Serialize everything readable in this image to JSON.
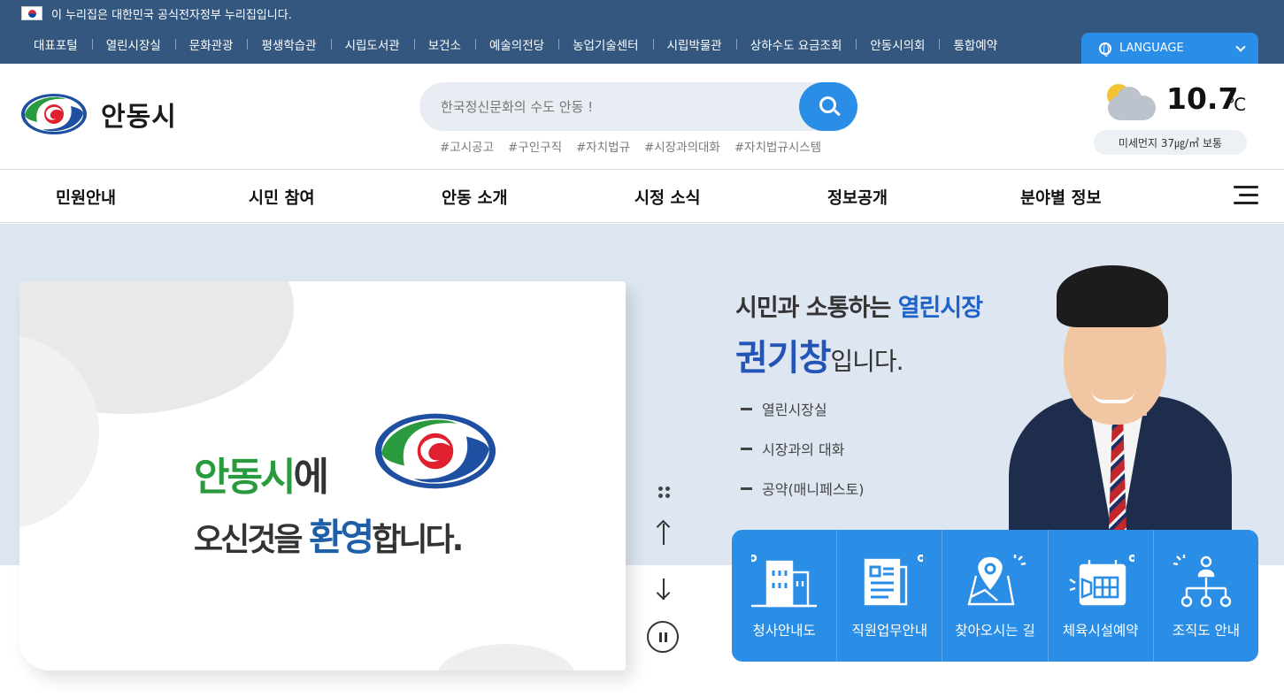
{
  "gov_banner": {
    "text": "이 누리집은 대한민국 공식전자정부 누리집입니다."
  },
  "top_nav": [
    "대표포털",
    "열린시장실",
    "문화관광",
    "평생학습관",
    "시립도서관",
    "보건소",
    "예술의전당",
    "농업기술센터",
    "시립박물관",
    "상하수도 요금조회",
    "안동시의회",
    "통합예약"
  ],
  "language": {
    "label": "LANGUAGE"
  },
  "logo": {
    "text": "안동시"
  },
  "search": {
    "placeholder": "한국정신문화의 수도 안동 !"
  },
  "tags": [
    "#고시공고",
    "#구인구직",
    "#자치법규",
    "#시장과의대화",
    "#자치법규시스템"
  ],
  "weather": {
    "temp": "10.7",
    "unit": "℃",
    "dust": "미세먼지 37㎍/㎥ 보통",
    "icon": "partly-cloudy-icon"
  },
  "main_nav": [
    "민원안내",
    "시민 참여",
    "안동 소개",
    "시정 소식",
    "정보공개",
    "분야별 정보"
  ],
  "hero_card": {
    "line1_green": "안동시",
    "line1_dark": "에",
    "line2_pre": "오신것을 ",
    "line2_blue": "환영",
    "line2_post": "합니다."
  },
  "mayor": {
    "line1_pre": "시민과 소통하는 ",
    "line1_blue": "열린시장",
    "name": "권기창",
    "line2_post": "입니다.",
    "links": [
      "열린시장실",
      "시장과의 대화",
      "공약(매니페스토)"
    ]
  },
  "quick_menu": [
    {
      "label": "청사안내도",
      "icon": "building-icon"
    },
    {
      "label": "직원업무안내",
      "icon": "document-icon"
    },
    {
      "label": "찾아오시는 길",
      "icon": "map-pin-icon"
    },
    {
      "label": "체육시설예약",
      "icon": "calendar-icon"
    },
    {
      "label": "조직도 안내",
      "icon": "org-chart-icon"
    }
  ],
  "colors": {
    "topbar": "#34577f",
    "accent": "#2b8ee6",
    "green": "#2a9a3e",
    "blue": "#1f5fa8"
  }
}
